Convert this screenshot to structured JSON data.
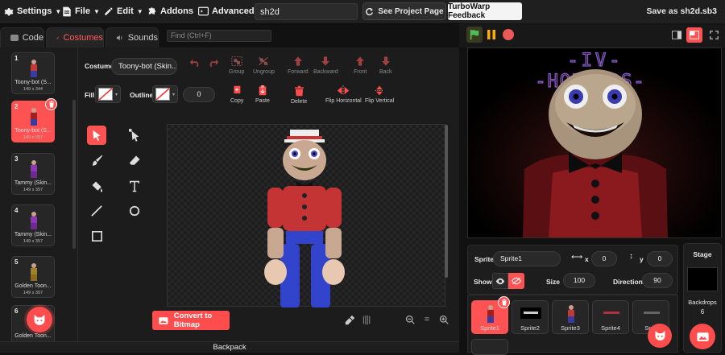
{
  "menubar": {
    "settings": "Settings",
    "file": "File",
    "edit": "Edit",
    "addons": "Addons",
    "advanced": "Advanced",
    "project_title": "sh2d",
    "see_project_page": "See Project Page",
    "feedback": "TurboWarp Feedback",
    "save_as": "Save as sh2d.sb3"
  },
  "tabs": {
    "code": "Code",
    "costumes": "Costumes",
    "sounds": "Sounds"
  },
  "find": {
    "placeholder": "Find (Ctrl+F)"
  },
  "costumes": [
    {
      "num": "1",
      "name": "Toony-bot (S...",
      "dim": "149 x 344",
      "color": "#3a3aa0"
    },
    {
      "num": "2",
      "name": "Toony-bot (S...",
      "dim": "149 x 357",
      "color": "#3a3aa0",
      "selected": true
    },
    {
      "num": "3",
      "name": "Tammy (Skin...",
      "dim": "149 x 357",
      "color": "#8a3ab0"
    },
    {
      "num": "4",
      "name": "Tammy (Skin...",
      "dim": "149 x 357",
      "color": "#8a3ab0"
    },
    {
      "num": "5",
      "name": "Golden Toon...",
      "dim": "149 x 357",
      "color": "#8a6a20"
    },
    {
      "num": "6",
      "name": "Golden Toon...",
      "dim": "",
      "color": "#8a6a20"
    }
  ],
  "editor": {
    "costume_label": "Costume",
    "costume_name": "Toony-bot (Skin...",
    "group": "Group",
    "ungroup": "Ungroup",
    "forward": "Forward",
    "backward": "Backward",
    "front": "Front",
    "back": "Back",
    "fill_label": "Fill",
    "outline_label": "Outline",
    "outline_width": "0",
    "copy": "Copy",
    "paste": "Paste",
    "delete": "Delete",
    "flip_h": "Flip Horizontal",
    "flip_v": "Flip Vertical",
    "convert": "Convert to Bitmap",
    "zoom_reset": "="
  },
  "stage_title": {
    "line1": "-IV-",
    "line2": "-HORRORS-"
  },
  "sprite_info": {
    "sprite_label": "Sprite",
    "sprite_name": "Sprite1",
    "x_label": "x",
    "x_value": "0",
    "y_label": "y",
    "y_value": "0",
    "show_label": "Show",
    "size_label": "Size",
    "size_value": "100",
    "direction_label": "Direction",
    "direction_value": "90"
  },
  "sprites": [
    {
      "name": "Sprite1",
      "selected": true
    },
    {
      "name": "Sprite2"
    },
    {
      "name": "Sprite3"
    },
    {
      "name": "Sprite4"
    },
    {
      "name": "Sprit"
    }
  ],
  "stage_panel": {
    "title": "Stage",
    "backdrops_label": "Backdrops",
    "backdrops_count": "6"
  },
  "backpack": "Backpack",
  "colors": {
    "accent": "#ff4d4d",
    "bg": "#111111",
    "panel": "#1c1c1c"
  }
}
